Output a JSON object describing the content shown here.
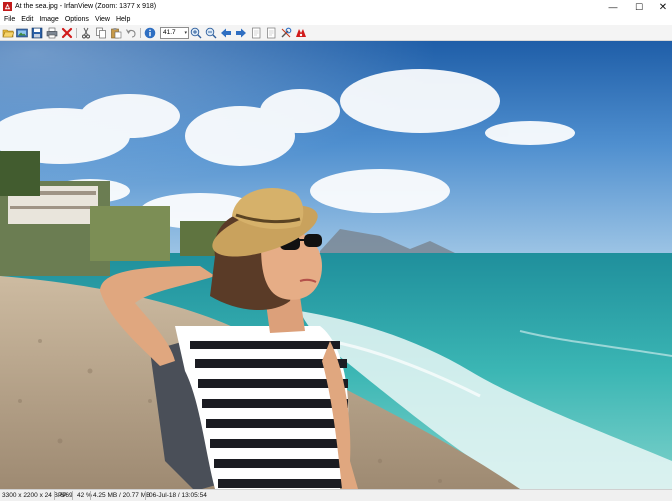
{
  "window": {
    "title": "At the sea.jpg - IrfanView (Zoom: 1377 x 918)",
    "minimize_glyph": "—",
    "maximize_glyph": "☐",
    "close_glyph": "✕"
  },
  "menu": {
    "items": [
      {
        "label": "File"
      },
      {
        "label": "Edit"
      },
      {
        "label": "Image"
      },
      {
        "label": "Options"
      },
      {
        "label": "View"
      },
      {
        "label": "Help"
      }
    ]
  },
  "toolbar": {
    "zoom_value": "41.7",
    "zoom_arrow": "▾",
    "icons": [
      "open-folder-icon",
      "slideshow-icon",
      "save-icon",
      "print-icon",
      "delete-icon",
      "cut-icon",
      "copy-icon",
      "paste-icon",
      "undo-icon",
      "info-icon",
      "zoom-in-icon",
      "zoom-out-icon",
      "previous-icon",
      "next-icon",
      "first-page-icon",
      "last-page-icon",
      "settings-icon",
      "exit-icon"
    ]
  },
  "image": {
    "description_icon": "photo-canvas"
  },
  "status": {
    "dimensions": "3300 x 2200 x 24 BPP",
    "position": "6/69",
    "zoom": "42 %",
    "filesize": "4.25 MB / 20.77 MB",
    "datetime": "06-Jul-18 / 13:05:54"
  },
  "colors": {
    "sky_top": "#2f6db2",
    "sea": "#39b3b0",
    "sand": "#b9a68c",
    "toolbar_bg": "#f4f4f4",
    "status_bg": "#f0f0f0"
  }
}
